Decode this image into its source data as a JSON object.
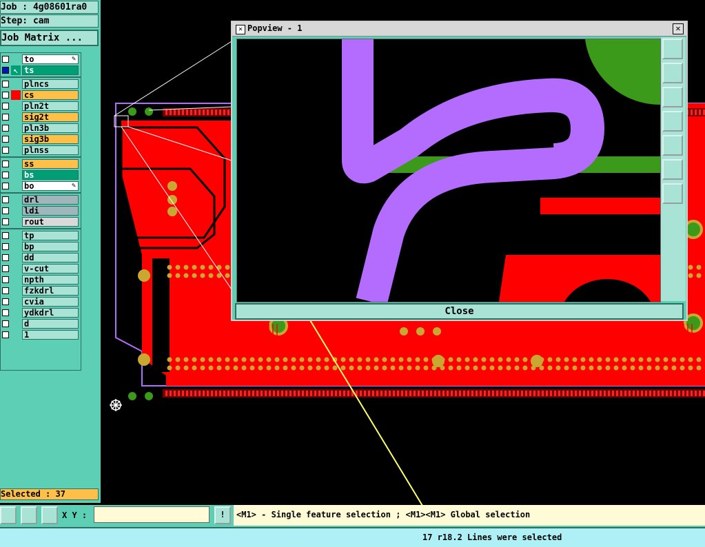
{
  "job": {
    "label": "Job : 4g08601ra0",
    "step": "Step: cam",
    "matrix_button": "Job Matrix ..."
  },
  "layers": [
    {
      "name": "to",
      "style": "white",
      "checked": false,
      "marker": "pencil"
    },
    {
      "name": "ts",
      "style": "green",
      "checked": true,
      "marker": "arrow"
    },
    {
      "name": "plncs",
      "style": "teal",
      "checked": false
    },
    {
      "name": "cs",
      "style": "orange",
      "checked": false,
      "marker": "red"
    },
    {
      "name": "pln2t",
      "style": "teal",
      "checked": false
    },
    {
      "name": "sig2t",
      "style": "orange",
      "checked": false
    },
    {
      "name": "pln3b",
      "style": "teal",
      "checked": false
    },
    {
      "name": "sig3b",
      "style": "orange",
      "checked": false
    },
    {
      "name": "plnss",
      "style": "teal",
      "checked": false
    },
    {
      "name": "ss",
      "style": "orange",
      "checked": false
    },
    {
      "name": "bs",
      "style": "green",
      "checked": false
    },
    {
      "name": "bo",
      "style": "white",
      "checked": false,
      "marker": "pencil"
    },
    {
      "name": "drl",
      "style": "gray",
      "checked": false
    },
    {
      "name": "ldi",
      "style": "gray",
      "checked": false
    },
    {
      "name": "rout",
      "style": "lgray",
      "checked": false
    },
    {
      "name": "tp",
      "style": "teal",
      "checked": false
    },
    {
      "name": "bp",
      "style": "teal",
      "checked": false
    },
    {
      "name": "dd",
      "style": "teal",
      "checked": false
    },
    {
      "name": "v-cut",
      "style": "teal",
      "checked": false
    },
    {
      "name": "npth",
      "style": "teal",
      "checked": false
    },
    {
      "name": "fzkdrl",
      "style": "teal",
      "checked": false
    },
    {
      "name": "cvia",
      "style": "teal",
      "checked": false
    },
    {
      "name": "ydkdrl",
      "style": "teal",
      "checked": false
    },
    {
      "name": "d",
      "style": "teal",
      "checked": false
    },
    {
      "name": "1",
      "style": "teal",
      "checked": false
    }
  ],
  "selected": "Selected : 37",
  "popview": {
    "title": "Popview - 1",
    "close_button": "Close"
  },
  "toolbar": {
    "xy_label": "X Y :",
    "xy_value": "",
    "exclaim": "!"
  },
  "hint": "<M1> - Single feature selection ; <M1><M1> Global selection",
  "status": "17 r18.2 Lines were selected",
  "colors": {
    "panel": "#5ccfb4",
    "pcb_copper": "#ff0000",
    "trace": "#b46cff",
    "pad": "#c8a830",
    "green_layer": "#3c9a1a"
  }
}
